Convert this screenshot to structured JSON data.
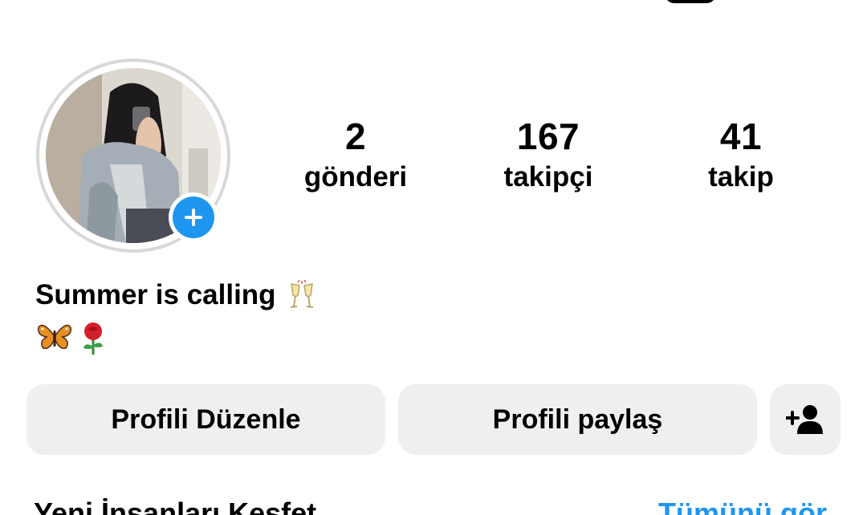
{
  "stats": {
    "posts": {
      "count": "2",
      "label": "gönderi"
    },
    "followers": {
      "count": "167",
      "label": "takipçi"
    },
    "following": {
      "count": "41",
      "label": "takip"
    }
  },
  "bio": {
    "line1": "Summer is calling",
    "line1_emoji": "champagne-glasses-icon",
    "line2_emoji": [
      "butterfly-icon",
      "rose-icon"
    ]
  },
  "buttons": {
    "edit_profile": "Profili Düzenle",
    "share_profile": "Profili paylaş",
    "add_user_icon": "add-person-icon"
  },
  "section": {
    "left_label": "Yeni İnsanları Keşfet",
    "right_link": "Tümünü gör"
  },
  "avatar": {
    "add_story_icon": "plus-icon"
  },
  "colors": {
    "accent": "#1e96f0",
    "button_bg": "#efefef",
    "ring": "#d8d8d8",
    "text": "#000000"
  }
}
